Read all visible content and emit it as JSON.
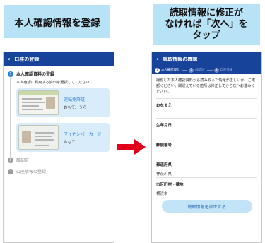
{
  "captions": {
    "left": "本人確認情報を登録",
    "right_line1": "読取情報に修正が",
    "right_line2": "なければ「次へ」を",
    "right_line3": "タップ"
  },
  "left_screen": {
    "title": "口座の登録",
    "back_icon": "chevron-left-icon",
    "steps": [
      {
        "number": "1",
        "label": "本人確認資料の登録"
      },
      {
        "number": "2",
        "label": "顔認証"
      },
      {
        "number": "3",
        "label": "口座情報の登録"
      }
    ],
    "instruction": "本人確認に利用する資料を選択してください。",
    "options": [
      {
        "title": "運転免許証",
        "subtitle": "おもて、うら"
      },
      {
        "title": "マイナンバーカード",
        "subtitle": "おもて"
      }
    ]
  },
  "right_screen": {
    "title": "読取情報の確認",
    "back_icon": "chevron-left-icon",
    "progress_steps": [
      {
        "number": "1",
        "label": "本人確認資料"
      },
      {
        "number": "2",
        "label": "顔認証"
      },
      {
        "number": "3",
        "label": "口座情報"
      }
    ],
    "intro": "撮影した本人確認資料から読み取った情報が正しいか、ご確認ください。間違えている箇所は修正してから次へお進みください。",
    "fields": [
      {
        "label": "おなまえ",
        "value": ""
      },
      {
        "label": "生年月日",
        "value": ""
      },
      {
        "label": "郵便番号",
        "value": ""
      },
      {
        "label": "都道府県",
        "value": "神奈川県"
      },
      {
        "label": "市区町村・番地",
        "value": "横浜市"
      }
    ],
    "fix_button": "読取情報を修正する"
  },
  "colors": {
    "header": "#17439b",
    "caption_bg": "#b8e2f6",
    "accent": "#2c7fd6",
    "arrow": "#e2001a"
  }
}
